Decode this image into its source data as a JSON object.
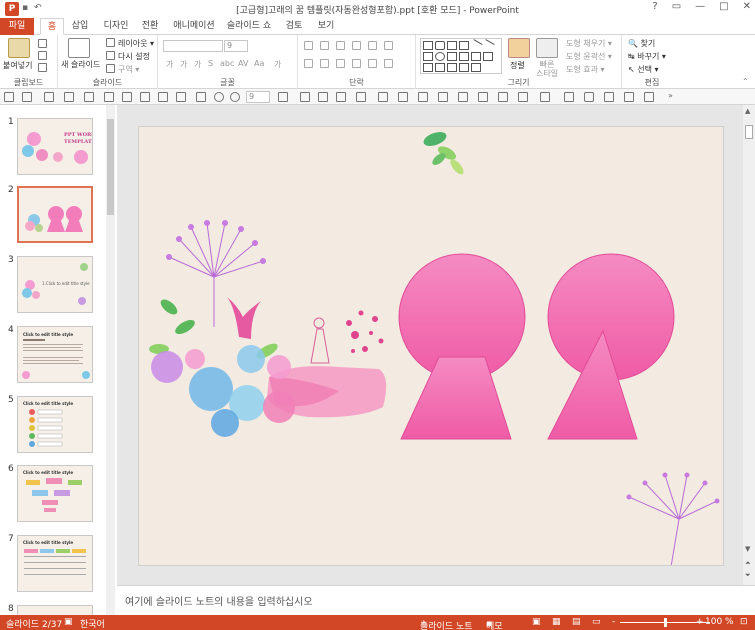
{
  "window": {
    "title": "[고급형]고래의 꿈 템플릿(자동완성형포함).ppt [호환 모드] - PowerPoint",
    "app_icon": "P",
    "controls": [
      "?",
      "▭",
      "—",
      "□",
      "✕"
    ]
  },
  "tabs": [
    {
      "label": "파일",
      "kind": "file"
    },
    {
      "label": "홈",
      "kind": "active"
    },
    {
      "label": "삽입"
    },
    {
      "label": "디자인"
    },
    {
      "label": "전환"
    },
    {
      "label": "애니메이션"
    },
    {
      "label": "슬라이드 쇼"
    },
    {
      "label": "검토"
    },
    {
      "label": "보기"
    }
  ],
  "ribbon": {
    "clipboard": {
      "label": "클립보드",
      "paste": "붙여넣기"
    },
    "slides": {
      "label": "슬라이드",
      "new_slide": "새 슬라이드",
      "layout": "레이아웃 ▾",
      "reset": "다시 설정",
      "section": "구역 ▾"
    },
    "font": {
      "label": "글꼴",
      "font_name": "",
      "font_size": "9",
      "buttons": [
        "가",
        "가",
        "가",
        "S",
        "abc",
        "AV",
        "Aa",
        "가"
      ]
    },
    "paragraph": {
      "label": "단락"
    },
    "drawing": {
      "label": "그리기",
      "arrange": "정렬",
      "quick_styles": "빠른\n스타일",
      "fill": "도형 채우기 ▾",
      "outline": "도형 윤곽선 ▾",
      "effects": "도형 효과 ▾"
    },
    "editing": {
      "label": "편집",
      "find": "찾기",
      "replace": "바꾸기 ▾",
      "select": "선택 ▾"
    }
  },
  "toolbar2": {
    "font_size": "9"
  },
  "thumbnails": [
    {
      "num": "1",
      "title": "PPT WORLD TEMPLATE"
    },
    {
      "num": "2",
      "title": ""
    },
    {
      "num": "3",
      "title": "1.Click to edit title style"
    },
    {
      "num": "4",
      "title": "Click to edit title style"
    },
    {
      "num": "5",
      "title": "Click to edit title style"
    },
    {
      "num": "6",
      "title": "Click to edit title style"
    },
    {
      "num": "7",
      "title": "Click to edit title style"
    },
    {
      "num": "8",
      "title": ""
    }
  ],
  "notes": {
    "placeholder": "여기에 슬라이드 노트의 내용을 입력하십시오"
  },
  "status": {
    "slide_info": "슬라이드 2/37",
    "language": "한국어",
    "notes_btn": "슬라이드 노트",
    "comments_btn": "메모",
    "zoom_minus": "-",
    "zoom_plus": "+",
    "zoom": "100 %"
  },
  "colors": {
    "accent": "#d24726",
    "keyhole": "#f26fb2",
    "slide_bg": "#f3ebe1"
  }
}
